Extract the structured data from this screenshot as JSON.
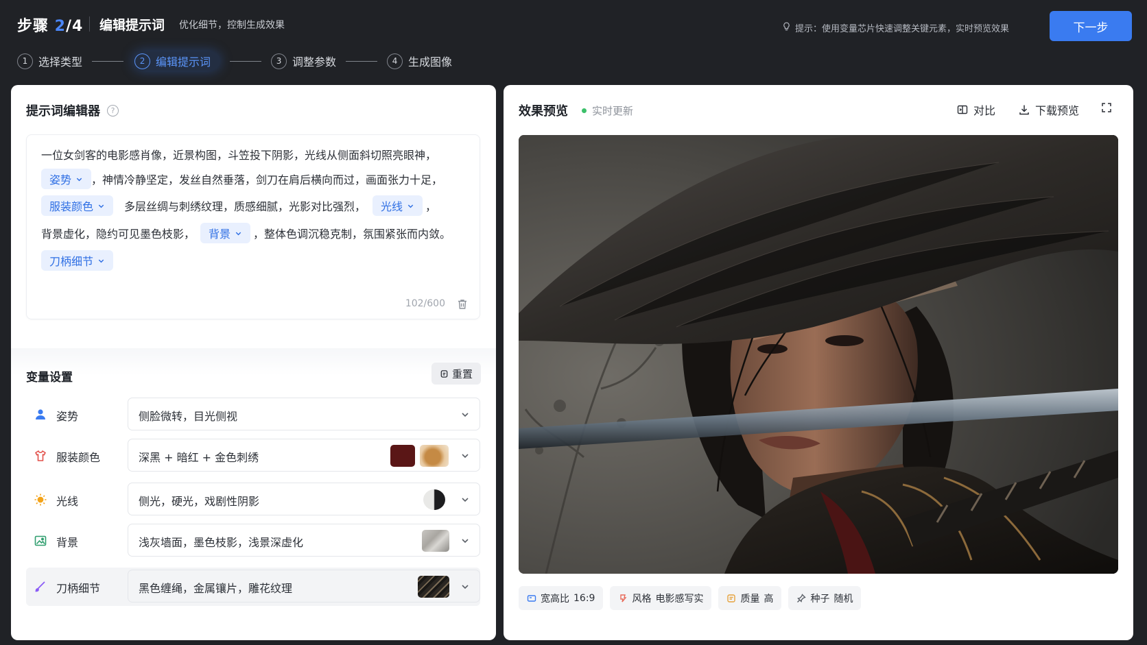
{
  "header": {
    "step_prefix": "步骤 ",
    "step_current": "2",
    "step_total": "/4",
    "title": "编辑提示词",
    "subtitle": "优化细节，控制生成效果",
    "hint": "提示：使用变量芯片快速调整关键元素，实时预览效果",
    "next_button": "下一步"
  },
  "stepper": [
    {
      "num": "1",
      "label": "选择类型"
    },
    {
      "num": "2",
      "label": "编辑提示词"
    },
    {
      "num": "3",
      "label": "调整参数"
    },
    {
      "num": "4",
      "label": "生成图像"
    }
  ],
  "editor": {
    "title": "提示词编辑器",
    "line1": "一位女剑客的电影感肖像，近景构图，斗笠投下阴影，光线从侧面斜切照亮眼神，",
    "chip_pose": "姿势",
    "line2_text": "，神情冷静坚定，发丝自然垂落，剑刀在肩后横向而过，画面张力十足，",
    "chip_outfit": "服装颜色",
    "line3_text": "多层丝绸与刺绣纹理，质感细腻，光影对比强烈，",
    "chip_light": "光线",
    "line3_end": "，",
    "line4_text": "背景虚化，隐约可见墨色枝影，",
    "chip_bg": "背景",
    "line4_end": "，整体色调沉稳克制，氛围紧张而内敛。",
    "chip_hilt": "刀柄细节",
    "counter": "102/600"
  },
  "variables": {
    "title": "变量设置",
    "reset": "重置",
    "rows": [
      {
        "label": "姿势",
        "value": "侧脸微转，目光侧视"
      },
      {
        "label": "服装颜色",
        "value": "深黑 + 暗红 + 金色刺绣"
      },
      {
        "label": "光线",
        "value": "侧光，硬光，戏剧性阴影"
      },
      {
        "label": "背景",
        "value": "浅灰墙面，墨色枝影，浅景深虚化"
      },
      {
        "label": "刀柄细节",
        "value": "黑色缠绳，金属镶片，雕花纹理"
      }
    ],
    "colors": {
      "outfit_red": "#5a1616",
      "outfit_gold": "#c89458"
    }
  },
  "preview": {
    "title": "效果预览",
    "live": "实时更新",
    "compare": "对比",
    "download": "下载预览",
    "meta": [
      {
        "label": "宽高比",
        "value": "16:9"
      },
      {
        "label": "风格",
        "value": "电影感写实"
      },
      {
        "label": "质量",
        "value": "高"
      },
      {
        "label": "种子",
        "value": "随机"
      }
    ]
  },
  "colors": {
    "accent": "#3a7bf0",
    "chip_bg": "#e9f0fe",
    "chip_text": "#2f6fe4"
  }
}
